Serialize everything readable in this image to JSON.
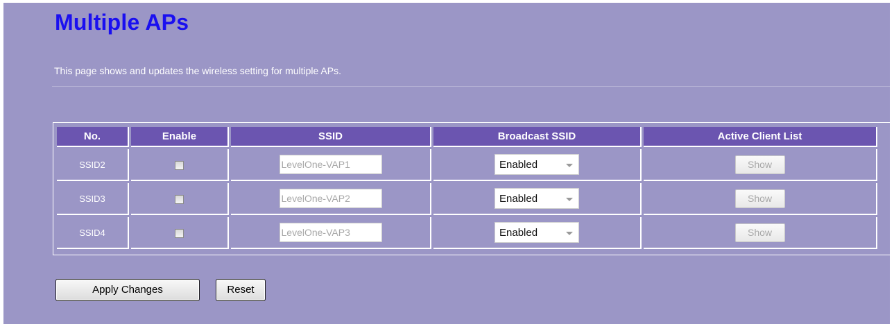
{
  "page": {
    "title": "Multiple APs",
    "description": "This page shows and updates the wireless setting for multiple APs."
  },
  "table": {
    "headers": [
      "No.",
      "Enable",
      "SSID",
      "Broadcast SSID",
      "Active Client List"
    ],
    "rows": [
      {
        "no": "SSID2",
        "enabled": false,
        "ssid": "LevelOne-VAP1",
        "broadcast": "Enabled",
        "action": "Show"
      },
      {
        "no": "SSID3",
        "enabled": false,
        "ssid": "LevelOne-VAP2",
        "broadcast": "Enabled",
        "action": "Show"
      },
      {
        "no": "SSID4",
        "enabled": false,
        "ssid": "LevelOne-VAP3",
        "broadcast": "Enabled",
        "action": "Show"
      }
    ]
  },
  "buttons": {
    "apply": "Apply Changes",
    "reset": "Reset"
  },
  "colors": {
    "background": "#9b96c6",
    "header": "#6b55b0",
    "title": "#1a0ff0"
  },
  "icons": {
    "dropdown": "chevron-down-icon"
  }
}
